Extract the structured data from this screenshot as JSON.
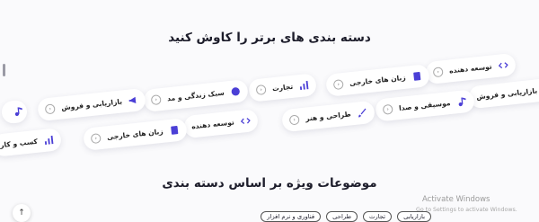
{
  "section_title": "دسته بندی های برتر را کاوش کنید",
  "featured_title": "موضوعات ویژه بر اساس دسته بندی",
  "row1": [
    {
      "label": "بازاریابی و فروش",
      "icon": "megaphone-icon"
    },
    {
      "label": "توسعه دهنده",
      "icon": "code-icon"
    },
    {
      "label": "زبان های خارجی",
      "icon": "book-icon"
    },
    {
      "label": "تجارت",
      "icon": "chart-icon"
    },
    {
      "label": "سبک زندگی و مد",
      "icon": "badge-icon"
    },
    {
      "label": "بازاریابی و فروش",
      "icon": "megaphone-icon"
    },
    {
      "label": "",
      "icon": "music-icon"
    }
  ],
  "row2": [
    {
      "label": "موسیقی و صدا",
      "icon": "music-icon"
    },
    {
      "label": "طراحی و هنر",
      "icon": "brush-icon"
    },
    {
      "label": "توسعه دهنده",
      "icon": "code-icon"
    },
    {
      "label": "زبان های خارجی",
      "icon": "book-icon"
    },
    {
      "label": "کسب و کار",
      "icon": "chart-icon"
    }
  ],
  "tags": [
    "بازاریابی",
    "تجارت",
    "طراحی",
    "فناوری و نرم افزار"
  ],
  "watermark": {
    "line1": "Activate Windows",
    "line2": "Go to Settings to activate Windows."
  },
  "accent": "#4b3fd6"
}
